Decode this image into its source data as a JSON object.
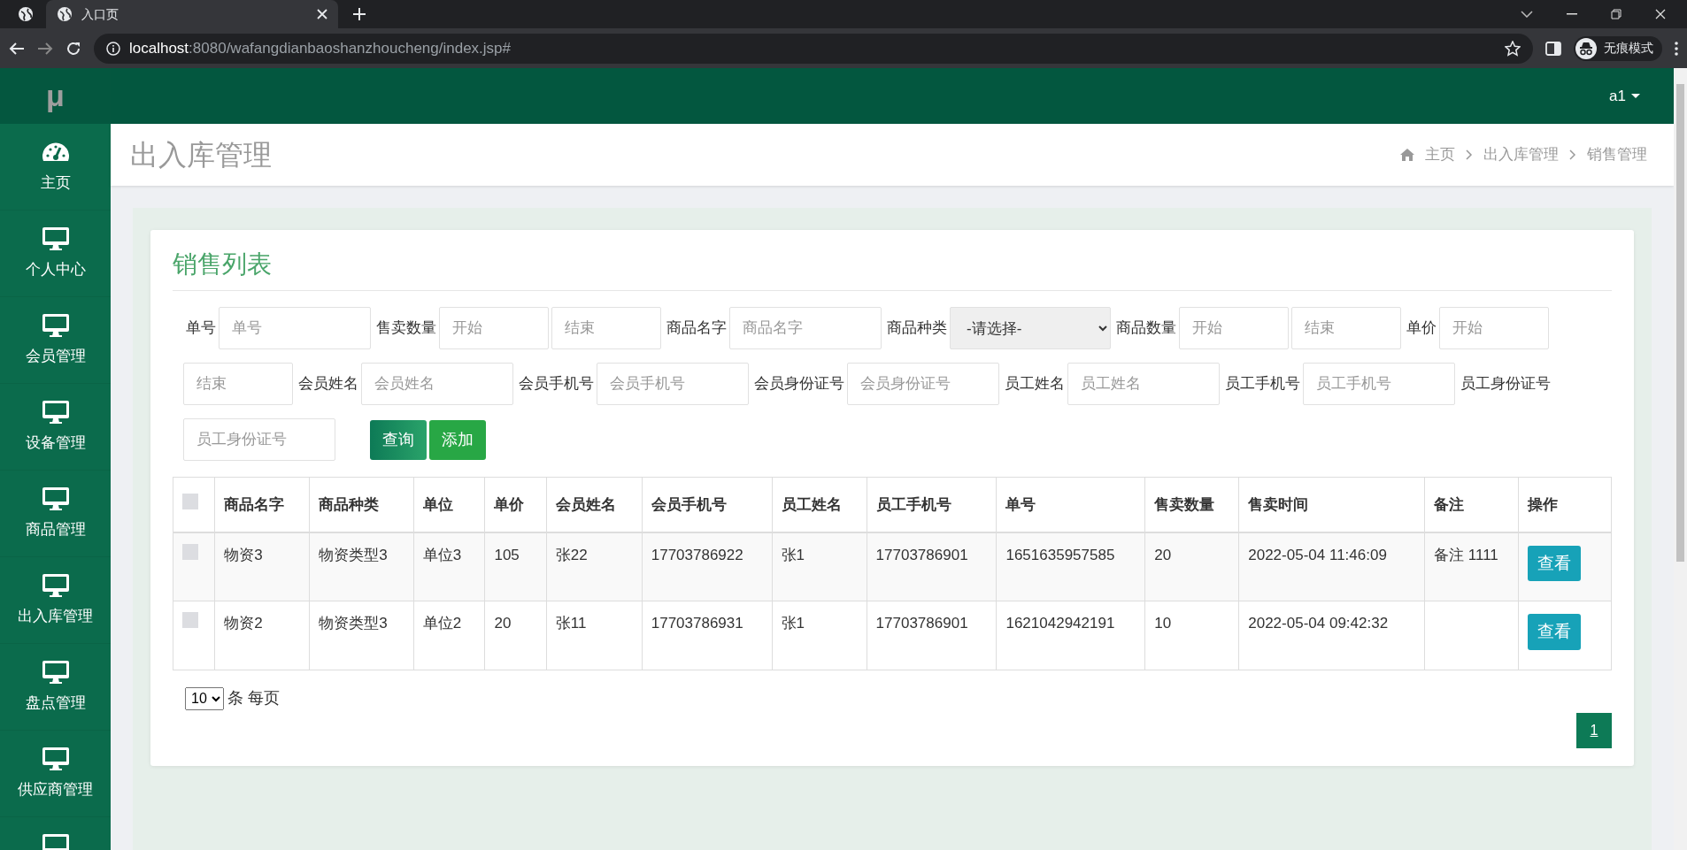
{
  "browser": {
    "tab_title": "入口页",
    "url_host": "localhost",
    "url_rest": ":8080/wafangdianbaoshanzhoucheng/index.jsp#",
    "incognito_label": "无痕模式"
  },
  "sidebar": {
    "logo": "μ",
    "items": [
      {
        "label": "主页",
        "kind": "dashboard"
      },
      {
        "label": "个人中心",
        "kind": "monitor"
      },
      {
        "label": "会员管理",
        "kind": "monitor"
      },
      {
        "label": "设备管理",
        "kind": "monitor"
      },
      {
        "label": "商品管理",
        "kind": "monitor"
      },
      {
        "label": "出入库管理",
        "kind": "monitor"
      },
      {
        "label": "盘点管理",
        "kind": "monitor"
      },
      {
        "label": "供应商管理",
        "kind": "monitor"
      },
      {
        "kind": "cut"
      }
    ]
  },
  "header": {
    "user": "a1"
  },
  "page": {
    "title": "出入库管理",
    "breadcrumb": [
      "主页",
      "出入库管理",
      "销售管理"
    ]
  },
  "panel": {
    "title": "销售列表",
    "filters": [
      {
        "kind": "label",
        "text": "单号"
      },
      {
        "kind": "text_input",
        "placeholder": "单号"
      },
      {
        "kind": "label",
        "text": "售卖数量"
      },
      {
        "kind": "range_input",
        "placeholder": "开始"
      },
      {
        "kind": "range_input",
        "placeholder": "结束"
      },
      {
        "kind": "label",
        "text": "商品名字"
      },
      {
        "kind": "text_input",
        "placeholder": "商品名字"
      },
      {
        "kind": "label",
        "text": "商品种类"
      },
      {
        "kind": "select",
        "value": "-请选择-"
      },
      {
        "kind": "label",
        "text": "商品数量"
      },
      {
        "kind": "range_input",
        "placeholder": "开始"
      },
      {
        "kind": "range_input",
        "placeholder": "结束"
      },
      {
        "kind": "label",
        "text": "单价"
      },
      {
        "kind": "range_input",
        "placeholder": "开始"
      },
      {
        "kind": "range_input",
        "placeholder": "结束"
      },
      {
        "kind": "label",
        "text": "会员姓名"
      },
      {
        "kind": "text_input",
        "placeholder": "会员姓名"
      },
      {
        "kind": "label",
        "text": "会员手机号"
      },
      {
        "kind": "text_input",
        "placeholder": "会员手机号"
      },
      {
        "kind": "label",
        "text": "会员身份证号"
      },
      {
        "kind": "text_input",
        "placeholder": "会员身份证号"
      },
      {
        "kind": "label",
        "text": "员工姓名"
      },
      {
        "kind": "text_input",
        "placeholder": "员工姓名"
      },
      {
        "kind": "label",
        "text": "员工手机号"
      },
      {
        "kind": "text_input",
        "placeholder": "员工手机号"
      },
      {
        "kind": "label",
        "text": "员工身份证号"
      },
      {
        "kind": "text_input",
        "placeholder": "员工身份证号"
      }
    ],
    "buttons": [
      {
        "label": "查询",
        "kind": "search"
      },
      {
        "label": "添加",
        "kind": "add"
      }
    ],
    "table": {
      "all_selected": false,
      "columns": [
        "商品名字",
        "商品种类",
        "单位",
        "单价",
        "会员姓名",
        "会员手机号",
        "员工姓名",
        "员工手机号",
        "单号",
        "售卖数量",
        "售卖时间",
        "备注",
        "操作"
      ],
      "rows": [
        {
          "selected": false,
          "cells": [
            "物资3",
            "物资类型3",
            "单位3",
            "105",
            "张22",
            "17703786922",
            "张1",
            "17703786901",
            "1651635957585",
            "20",
            "2022-05-04 11:46:09",
            "备注 1111"
          ],
          "action": "查看"
        },
        {
          "selected": false,
          "cells": [
            "物资2",
            "物资类型3",
            "单位2",
            "20",
            "张11",
            "17703786931",
            "张1",
            "17703786901",
            "1621042942191",
            "10",
            "2022-05-04 09:42:32"
          ],
          "action": "查看"
        }
      ]
    },
    "pagination": {
      "page_size": "10",
      "page_size_suffix": "条 每页",
      "pages": [
        {
          "label": "1",
          "selected": true
        }
      ]
    }
  }
}
